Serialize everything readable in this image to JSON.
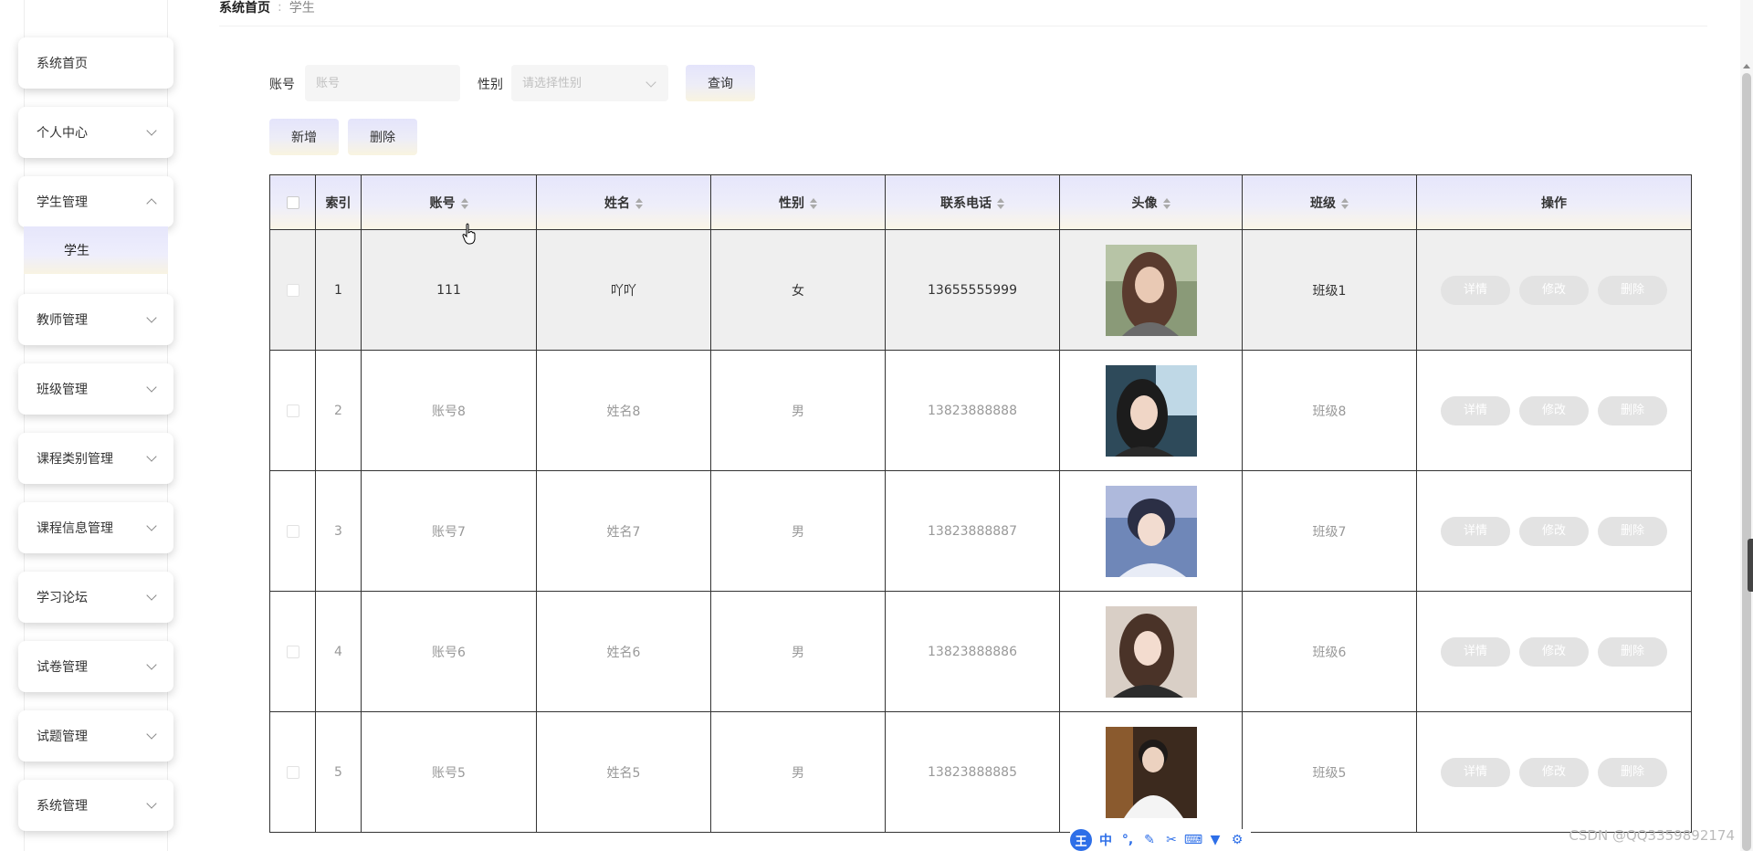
{
  "breadcrumb": {
    "home": "系统首页",
    "separator": ":",
    "current": "学生"
  },
  "sidebar": {
    "items": [
      {
        "label": "系统首页",
        "expanded": null
      },
      {
        "label": "个人中心",
        "expanded": false
      },
      {
        "label": "学生管理",
        "expanded": true
      },
      {
        "label": "教师管理",
        "expanded": false
      },
      {
        "label": "班级管理",
        "expanded": false
      },
      {
        "label": "课程类别管理",
        "expanded": false
      },
      {
        "label": "课程信息管理",
        "expanded": false
      },
      {
        "label": "学习论坛",
        "expanded": false
      },
      {
        "label": "试卷管理",
        "expanded": false
      },
      {
        "label": "试题管理",
        "expanded": false
      },
      {
        "label": "系统管理",
        "expanded": false
      }
    ],
    "submenu_active": "学生"
  },
  "search": {
    "account_label": "账号",
    "account_placeholder": "账号",
    "gender_label": "性别",
    "gender_placeholder": "请选择性别",
    "query_button": "查询"
  },
  "toolbar": {
    "add_button": "新增",
    "delete_button": "删除"
  },
  "table": {
    "headers": {
      "index": "索引",
      "account": "账号",
      "name": "姓名",
      "gender": "性别",
      "phone": "联系电话",
      "avatar": "头像",
      "class": "班级",
      "actions": "操作"
    },
    "action_labels": {
      "detail": "详情",
      "edit": "修改",
      "delete": "删除"
    },
    "rows": [
      {
        "index": "1",
        "account": "111",
        "name": "吖吖",
        "gender": "女",
        "phone": "13655555999",
        "class": "班级1"
      },
      {
        "index": "2",
        "account": "账号8",
        "name": "姓名8",
        "gender": "男",
        "phone": "13823888888",
        "class": "班级8"
      },
      {
        "index": "3",
        "account": "账号7",
        "name": "姓名7",
        "gender": "男",
        "phone": "13823888887",
        "class": "班级7"
      },
      {
        "index": "4",
        "account": "账号6",
        "name": "姓名6",
        "gender": "男",
        "phone": "13823888886",
        "class": "班级6"
      },
      {
        "index": "5",
        "account": "账号5",
        "name": "姓名5",
        "gender": "男",
        "phone": "13823888885",
        "class": "班级5"
      }
    ]
  },
  "ime_toolbar": {
    "badge": "王",
    "mode": "中",
    "punct": "°,",
    "icons": [
      "pen-icon",
      "scissors-icon",
      "keyboard-icon",
      "shirt-icon",
      "gear-icon"
    ]
  },
  "watermark": "CSDN @QQ3359892174",
  "colors": {
    "accent_blue": "#2e6fe8",
    "header_gradient_top": "#e6e6fb",
    "header_gradient_bottom": "#fbf6e6",
    "action_button": "#e3e3e3"
  }
}
